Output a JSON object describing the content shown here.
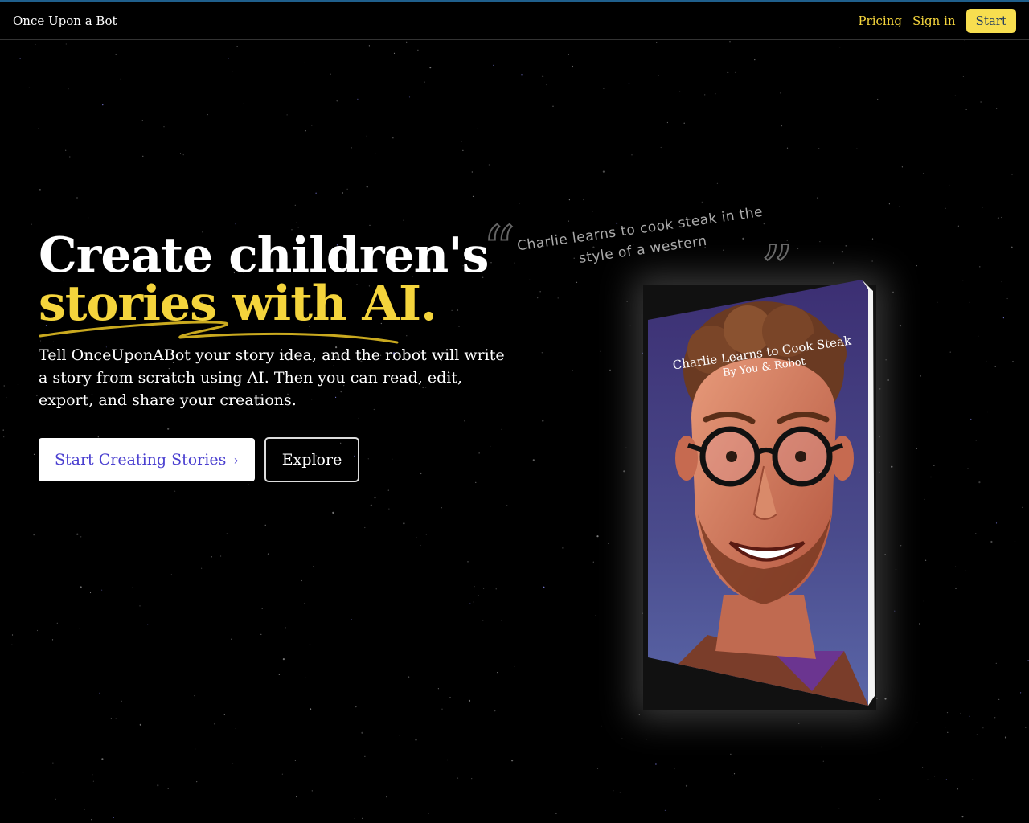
{
  "nav": {
    "brand": "Once Upon a Bot",
    "pricing": "Pricing",
    "sign_in": "Sign in",
    "start": "Start"
  },
  "hero": {
    "headline_line1": "Create children's",
    "headline_line2": "stories with AI.",
    "description": "Tell OnceUponABot your story idea, and the robot will write a story from scratch using AI. Then you can read, edit, export, and share your creations.",
    "primary_cta": "Start Creating Stories",
    "secondary_cta": "Explore"
  },
  "quote": {
    "text": "Charlie learns to cook steak in the style of a western"
  },
  "book": {
    "title": "Charlie Learns to Cook Steak",
    "author": "By You & Robot"
  },
  "colors": {
    "accent_yellow": "#f4d43c",
    "primary_button_text": "#4a3fd0",
    "background": "#000000"
  },
  "icons": {
    "primary_cta_icon": "chevron-right-icon",
    "open_quote": "open-quote-icon",
    "close_quote": "close-quote-icon"
  }
}
